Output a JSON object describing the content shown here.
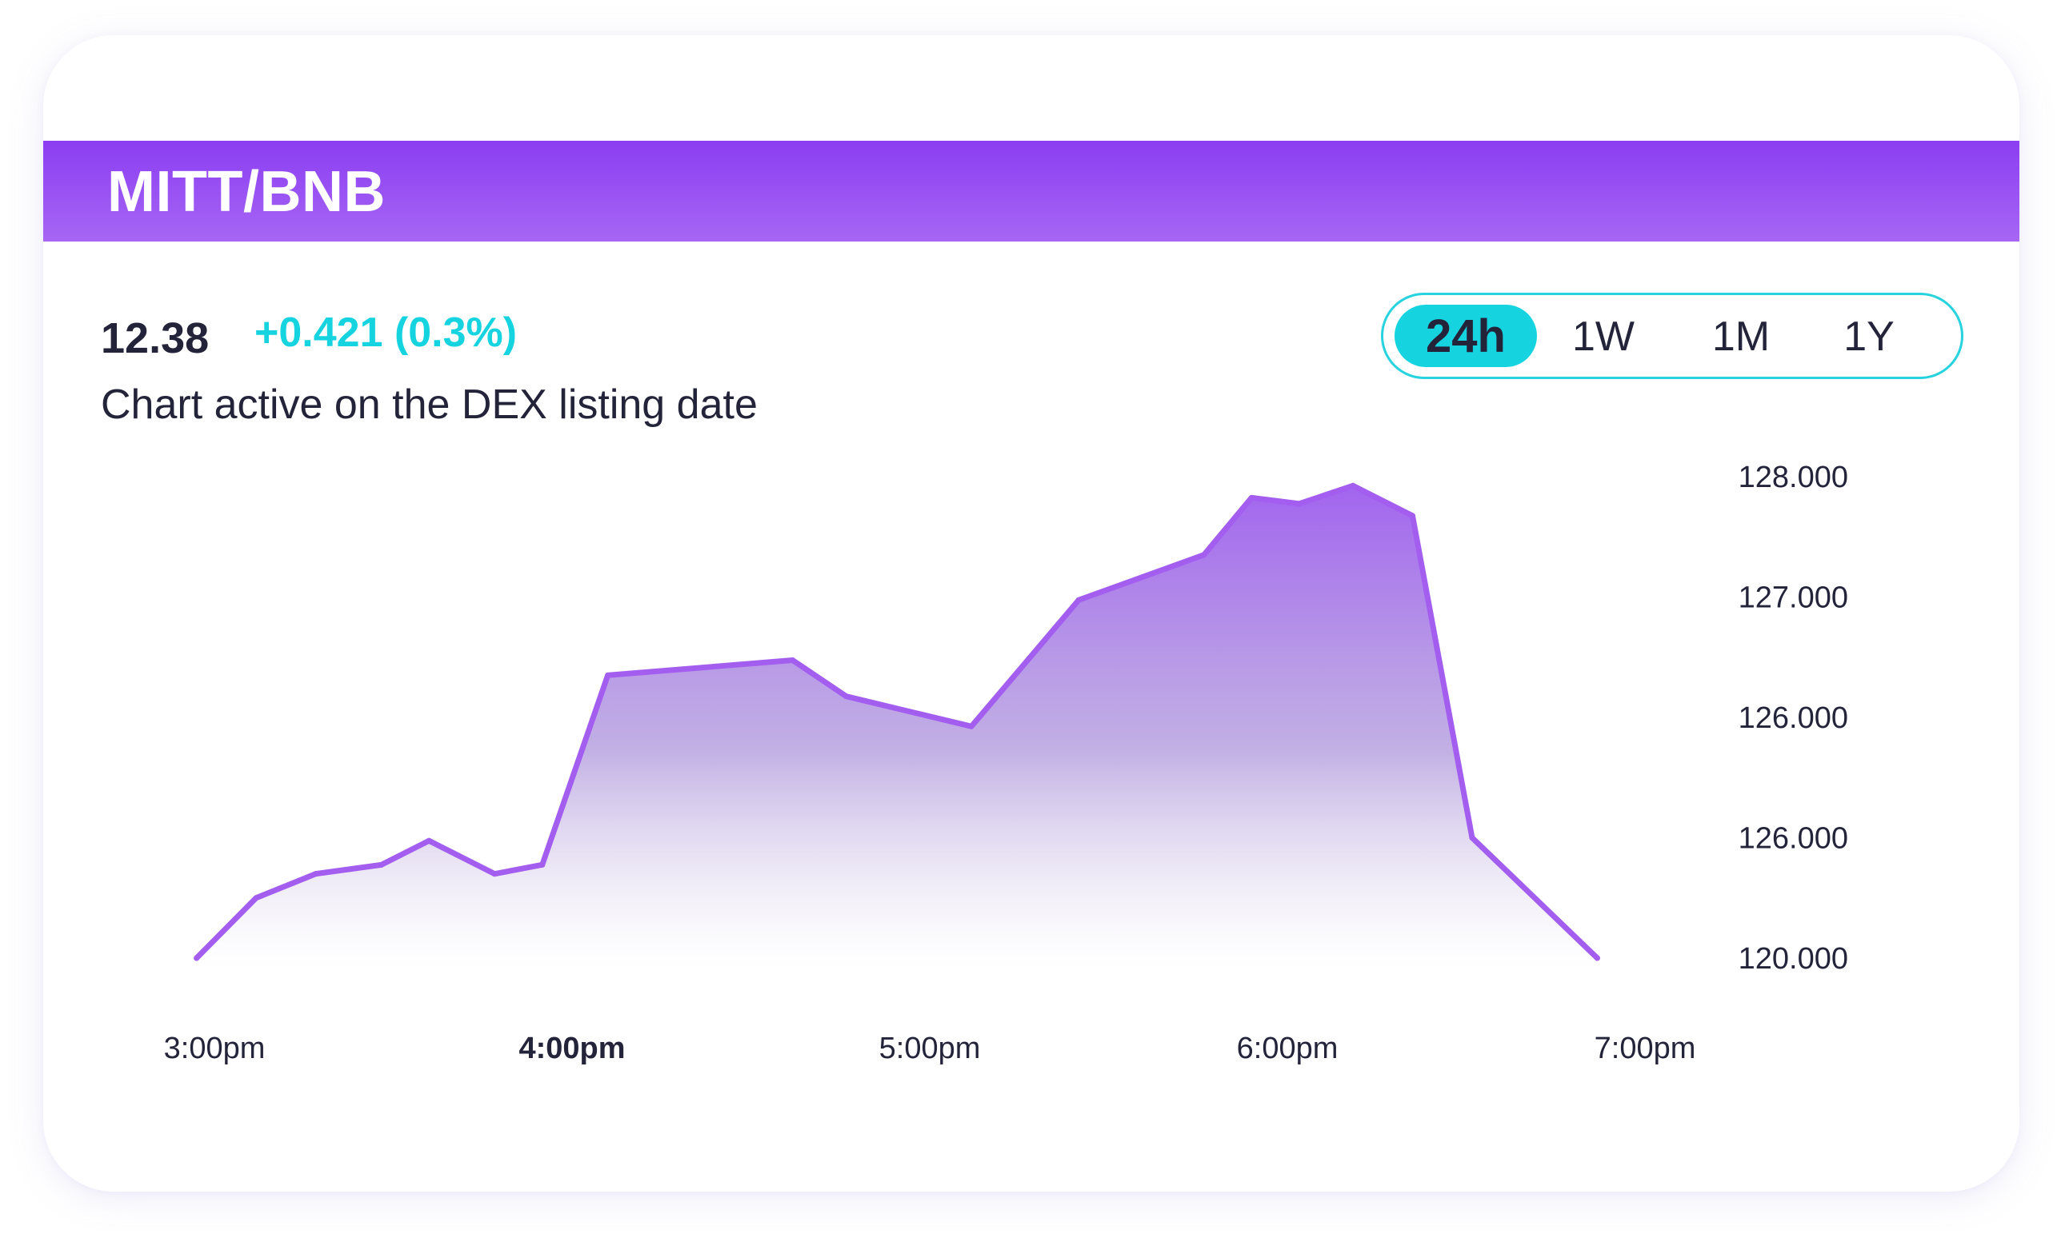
{
  "header": {
    "pair": "MITT/BNB"
  },
  "summary": {
    "price": "12.38",
    "change": "+0.421 (0.3%)",
    "note": "Chart active on the DEX listing date"
  },
  "range_selector": {
    "options": [
      "24h",
      "1W",
      "1M",
      "1Y"
    ],
    "selected": "24h"
  },
  "colors": {
    "accent": "#8b3ef2",
    "line": "#a35ef0",
    "positive": "#16d3e0",
    "text": "#23233a"
  },
  "chart_data": {
    "type": "area",
    "x": [
      "14:57",
      "15:07",
      "15:17",
      "15:28",
      "15:36",
      "15:47",
      "15:55",
      "16:06",
      "16:37",
      "16:46",
      "17:07",
      "17:25",
      "17:46",
      "17:54",
      "18:02",
      "18:11",
      "18:21",
      "18:31",
      "18:52",
      "19:03"
    ],
    "values": [
      120.0,
      121.0,
      121.4,
      121.55,
      121.95,
      121.4,
      121.55,
      124.7,
      124.95,
      124.35,
      123.85,
      125.95,
      126.7,
      127.65,
      127.55,
      127.85,
      127.35,
      122.0,
      120.0
    ],
    "x_ticks": [
      "3:00pm",
      "4:00pm",
      "5:00pm",
      "6:00pm",
      "7:00pm"
    ],
    "x_tick_bold": "4:00pm",
    "y_ticks": [
      {
        "label": "128.000",
        "value": 128
      },
      {
        "label": "127.000",
        "value": 126
      },
      {
        "label": "126.000",
        "value": 124
      },
      {
        "label": "126.000",
        "value": 122
      },
      {
        "label": "120.000",
        "value": 120
      }
    ],
    "ylim": [
      120,
      128
    ],
    "grid": false,
    "legend": "none"
  }
}
